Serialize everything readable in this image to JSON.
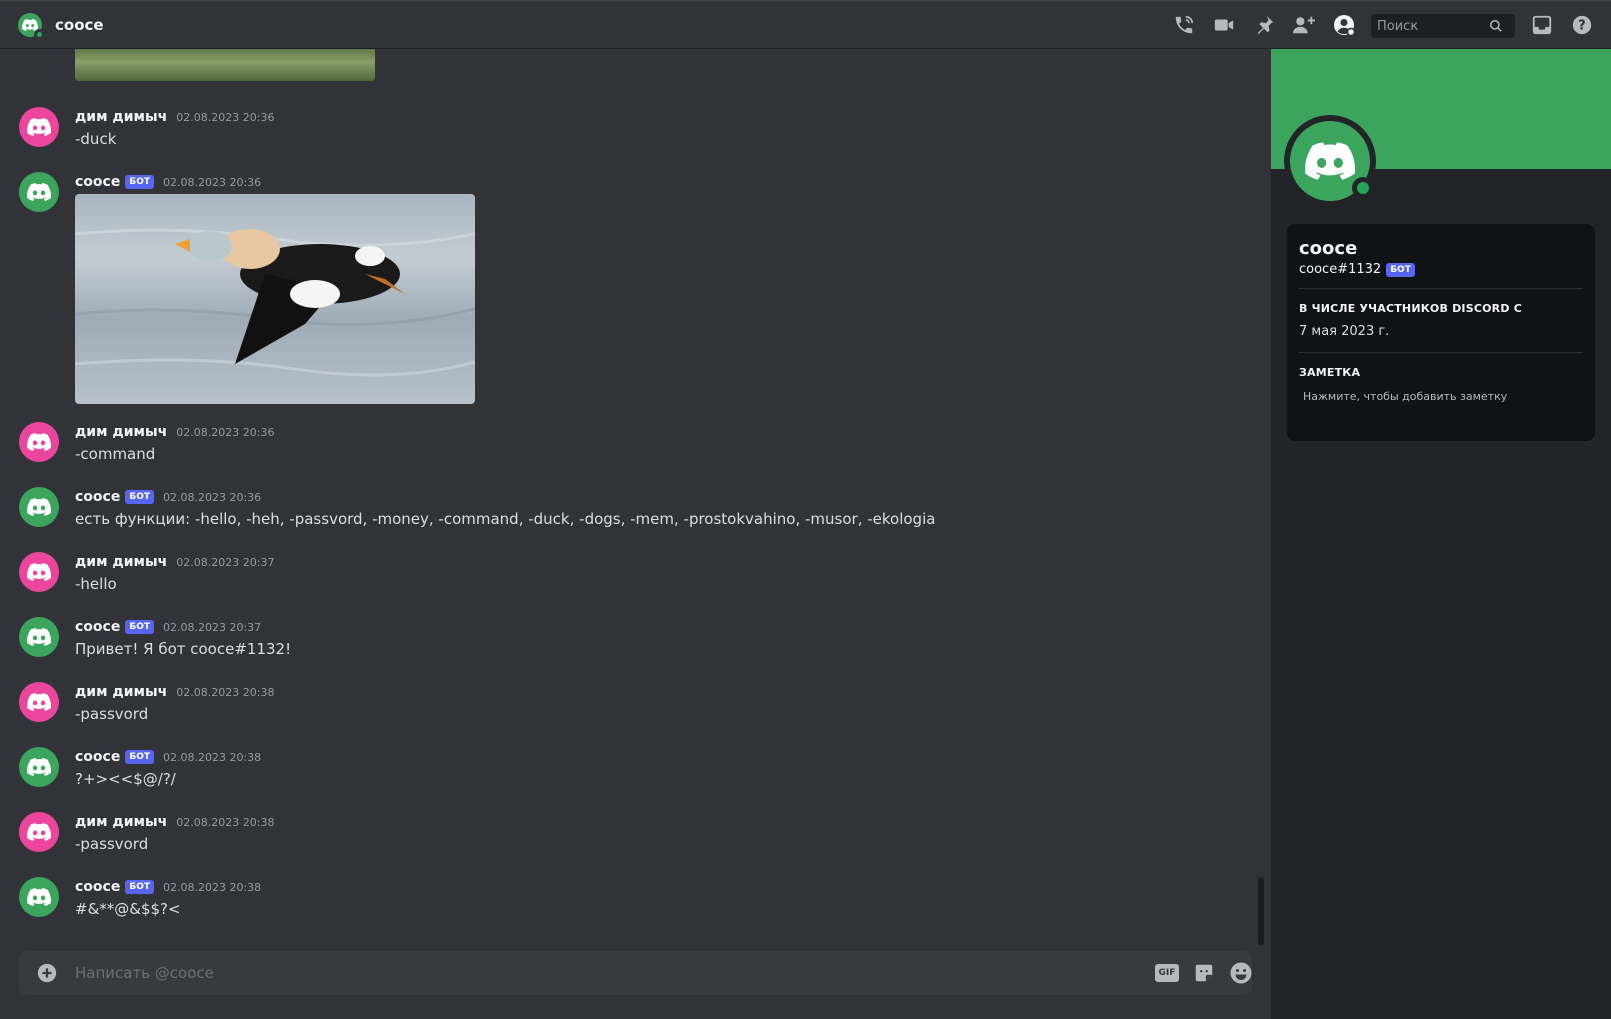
{
  "header": {
    "title": "cooce",
    "search_placeholder": "Поиск",
    "icons": [
      "phone-call-icon",
      "video-call-icon",
      "pin-icon",
      "add-friend-icon",
      "user-profile-icon",
      "inbox-icon",
      "help-icon"
    ]
  },
  "messages": [
    {
      "author": "дим димыч",
      "bot": false,
      "timestamp": "02.08.2023 20:36",
      "text": "-duck"
    },
    {
      "author": "cooce",
      "bot": true,
      "bot_label": "БОТ",
      "timestamp": "02.08.2023 20:36",
      "text": "",
      "image": "duck-image"
    },
    {
      "author": "дим димыч",
      "bot": false,
      "timestamp": "02.08.2023 20:36",
      "text": "-command"
    },
    {
      "author": "cooce",
      "bot": true,
      "bot_label": "БОТ",
      "timestamp": "02.08.2023 20:36",
      "text": "есть функции: -hello, -heh, -passvord, -money, -command, -duck, -dogs, -mem, -prostokvahino, -musor, -ekologia"
    },
    {
      "author": "дим димыч",
      "bot": false,
      "timestamp": "02.08.2023 20:37",
      "text": "-hello"
    },
    {
      "author": "cooce",
      "bot": true,
      "bot_label": "БОТ",
      "timestamp": "02.08.2023 20:37",
      "text": "Привет! Я бот cooce#1132!"
    },
    {
      "author": "дим димыч",
      "bot": false,
      "timestamp": "02.08.2023 20:38",
      "text": "-passvord"
    },
    {
      "author": "cooce",
      "bot": true,
      "bot_label": "БОТ",
      "timestamp": "02.08.2023 20:38",
      "text": "?+><<$@/?/"
    },
    {
      "author": "дим димыч",
      "bot": false,
      "timestamp": "02.08.2023 20:38",
      "text": "-passvord"
    },
    {
      "author": "cooce",
      "bot": true,
      "bot_label": "БОТ",
      "timestamp": "02.08.2023 20:38",
      "text": "#&**@&$$?<"
    }
  ],
  "composer": {
    "placeholder": "Написать @cooce",
    "gif_label": "GIF"
  },
  "profile": {
    "name": "cooce",
    "tag": "cooce#1132",
    "bot_label": "БОТ",
    "member_since_title": "В числе участников Discord с",
    "member_since_value": "7 мая 2023 г.",
    "note_title": "Заметка",
    "note_placeholder": "Нажмите, чтобы добавить заметку"
  },
  "colors": {
    "background": "#313338",
    "user_avatar": "#eb459e",
    "bot_avatar": "#3ba55d",
    "bot_tag": "#5865f2",
    "online": "#23a55a"
  }
}
